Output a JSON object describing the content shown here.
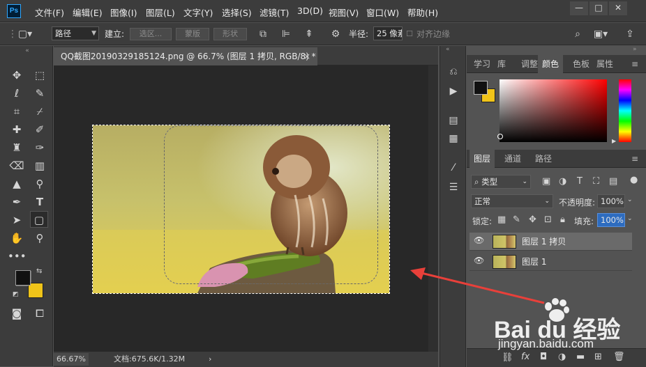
{
  "app": {
    "logo": "Ps"
  },
  "menu": [
    "文件(F)",
    "编辑(E)",
    "图像(I)",
    "图层(L)",
    "文字(Y)",
    "选择(S)",
    "滤镜(T)",
    "3D(D)",
    "视图(V)",
    "窗口(W)",
    "帮助(H)"
  ],
  "window_controls": {
    "minimize": "—",
    "maximize": "□",
    "close": "✕"
  },
  "options": {
    "mode": "路径",
    "build_label": "建立:",
    "selection_btn": "选区...",
    "mask_btn": "蒙版",
    "shape_btn": "形状",
    "radius_label": "半径:",
    "radius_value": "25 像素",
    "align_edges": "对齐边缘"
  },
  "document": {
    "tab_title": "QQ截图20190329185124.png @ 66.7% (图层 1 拷贝, RGB/8) *",
    "close": "×"
  },
  "status": {
    "zoom": "66.67%",
    "doc_info": "文档:675.6K/1.32M",
    "arrow": "›"
  },
  "panels_top": {
    "tabs": [
      "学习",
      "库",
      "调整",
      "颜色",
      "色板",
      "属性"
    ],
    "active": "颜色"
  },
  "panels_layers": {
    "tabs": [
      "图层",
      "通道",
      "路径"
    ],
    "active": "图层",
    "filter_kind": "类型",
    "blend_mode": "正常",
    "opacity_label": "不透明度:",
    "opacity_value": "100%",
    "lock_label": "锁定:",
    "fill_label": "填充:",
    "fill_value": "100%",
    "layers": [
      {
        "name": "图层 1 拷贝",
        "selected": true
      },
      {
        "name": "图层 1",
        "selected": false
      }
    ]
  },
  "watermark": {
    "brand": "Bai du 经验",
    "url": "jingyan.baidu.com"
  },
  "colors": {
    "foreground": "#111111",
    "background": "#f0c419",
    "annotation_arrow": "#e8403a"
  }
}
